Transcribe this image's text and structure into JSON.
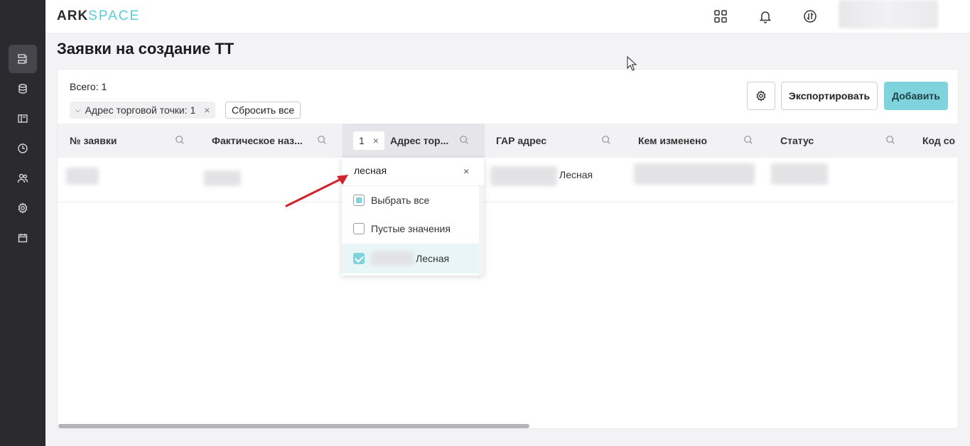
{
  "app": {
    "logo_part1": "ARK",
    "logo_part2": "SPACE"
  },
  "page": {
    "title": "Заявки на создание ТТ"
  },
  "toolbar": {
    "total_label": "Всего: 1",
    "filter_chip_label": "Адрес торговой точки: 1",
    "reset_label": "Сбросить все",
    "export_label": "Экспортировать",
    "add_label": "Добавить"
  },
  "table": {
    "columns": [
      "№ заявки",
      "Фактическое наз...",
      "Адрес тор...",
      "ГАР адрес",
      "Кем изменено",
      "Статус",
      "Код со"
    ],
    "active_filter_count": "1",
    "row": {
      "gar_address_suffix": "Лесная"
    }
  },
  "filter_dropdown": {
    "search_value": "лесная",
    "options": [
      {
        "label": "Выбрать все",
        "state": "partial"
      },
      {
        "label": "Пустые значения",
        "state": "unchecked"
      },
      {
        "label": "Лесная",
        "state": "checked"
      }
    ]
  },
  "colors": {
    "accent": "#7fd3dc",
    "sidebar": "#2b2b2f",
    "arrow": "#d4202a"
  },
  "icons": {
    "sidebar": [
      "requests-icon",
      "database-icon",
      "layout-icon",
      "clock-icon",
      "users-icon",
      "gear-icon",
      "calendar-icon"
    ],
    "header": [
      "apps-grid-icon",
      "bell-icon",
      "sync-icon"
    ]
  }
}
